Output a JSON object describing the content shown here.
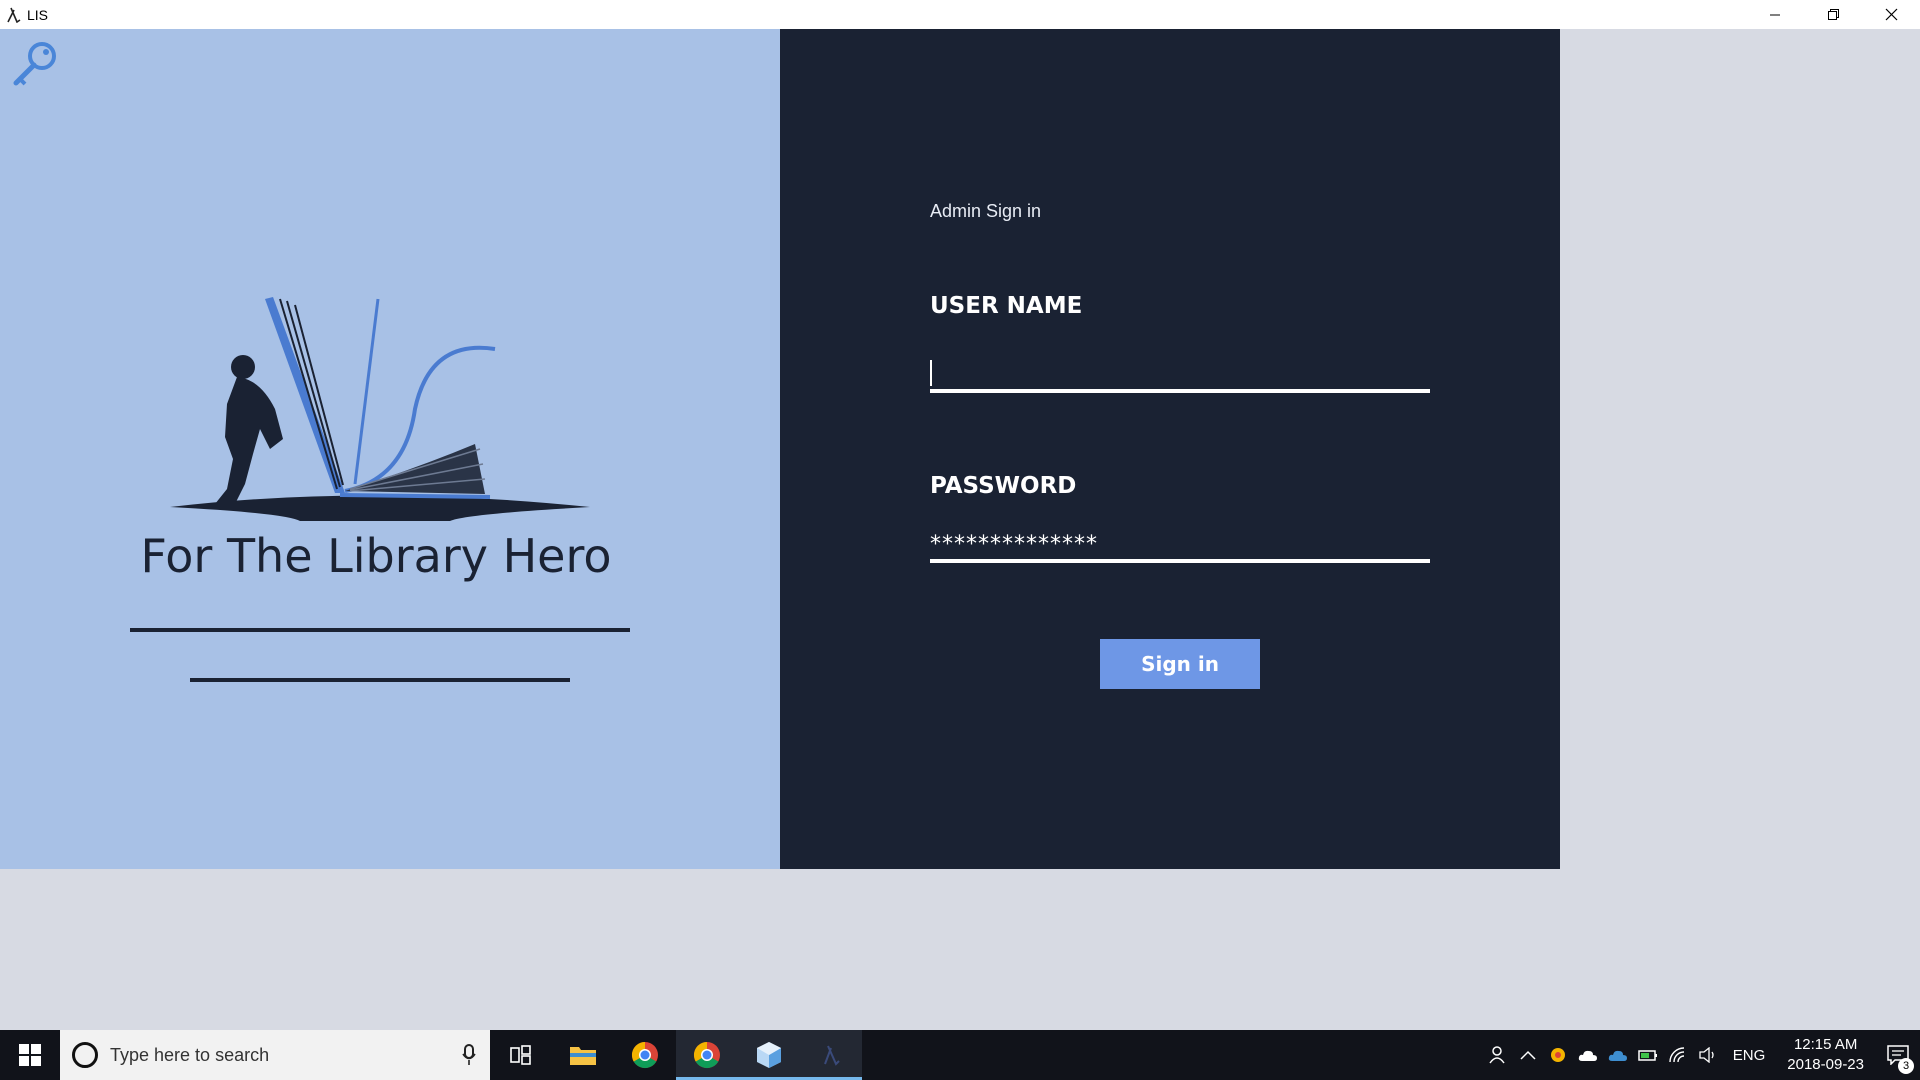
{
  "window": {
    "title": "LIS"
  },
  "left": {
    "hero_title": "For The Library Hero"
  },
  "form": {
    "heading": "Admin Sign in",
    "username_label": "USER NAME",
    "username_value": "",
    "password_label": "PASSWORD",
    "password_value": "**************",
    "signin_button": "Sign in"
  },
  "taskbar": {
    "search_placeholder": "Type here to search",
    "apps": [
      "Task View",
      "File Explorer",
      "Google Chrome",
      "Google Chrome",
      "3D Builder",
      "LIS"
    ],
    "language": "ENG",
    "time": "12:15 AM",
    "date": "2018-09-23",
    "notification_count": "3"
  },
  "colors": {
    "left_bg": "#a8c1e6",
    "right_bg": "#1a2233",
    "button": "#6e97e6",
    "desktop": "#d7dae3"
  }
}
